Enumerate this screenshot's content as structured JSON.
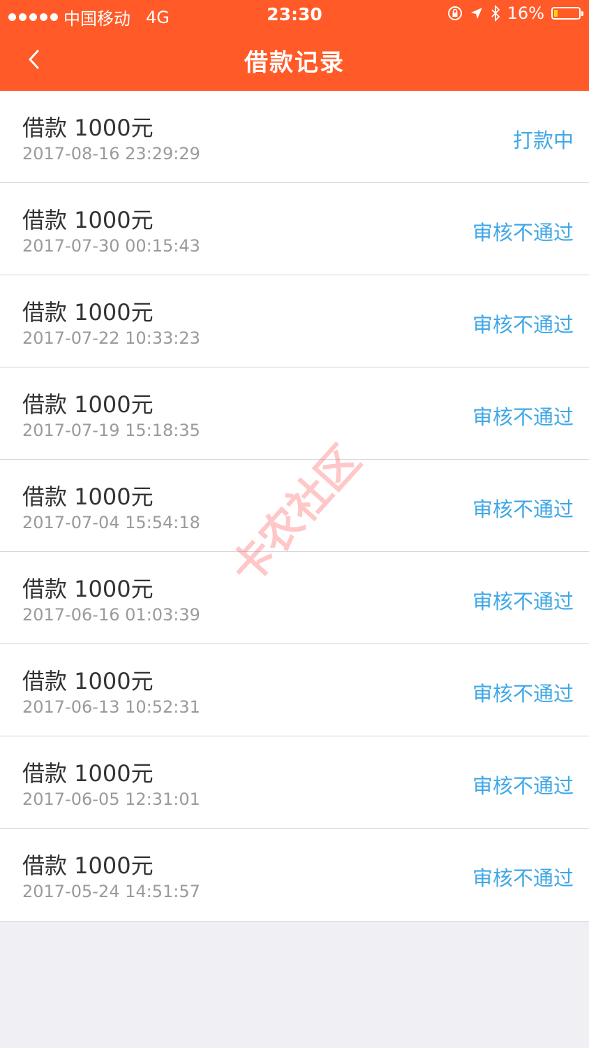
{
  "status_bar": {
    "carrier": "中国移动",
    "network": "4G",
    "time": "23:30",
    "battery_percent": "16%",
    "battery_level": 0.16
  },
  "nav": {
    "title": "借款记录",
    "back_icon": "chevron-left-icon"
  },
  "records": [
    {
      "title": "借款 1000元",
      "time": "2017-08-16 23:29:29",
      "status": "打款中"
    },
    {
      "title": "借款 1000元",
      "time": "2017-07-30 00:15:43",
      "status": "审核不通过"
    },
    {
      "title": "借款 1000元",
      "time": "2017-07-22 10:33:23",
      "status": "审核不通过"
    },
    {
      "title": "借款 1000元",
      "time": "2017-07-19 15:18:35",
      "status": "审核不通过"
    },
    {
      "title": "借款 1000元",
      "time": "2017-07-04 15:54:18",
      "status": "审核不通过"
    },
    {
      "title": "借款 1000元",
      "time": "2017-06-16 01:03:39",
      "status": "审核不通过"
    },
    {
      "title": "借款 1000元",
      "time": "2017-06-13 10:52:31",
      "status": "审核不通过"
    },
    {
      "title": "借款 1000元",
      "time": "2017-06-05 12:31:01",
      "status": "审核不通过"
    },
    {
      "title": "借款 1000元",
      "time": "2017-05-24 14:51:57",
      "status": "审核不通过"
    }
  ],
  "watermark": "卡农社区",
  "colors": {
    "header_bg": "#ff5a28",
    "status_text": "#3fa7e6",
    "page_bg": "#efeff4"
  }
}
